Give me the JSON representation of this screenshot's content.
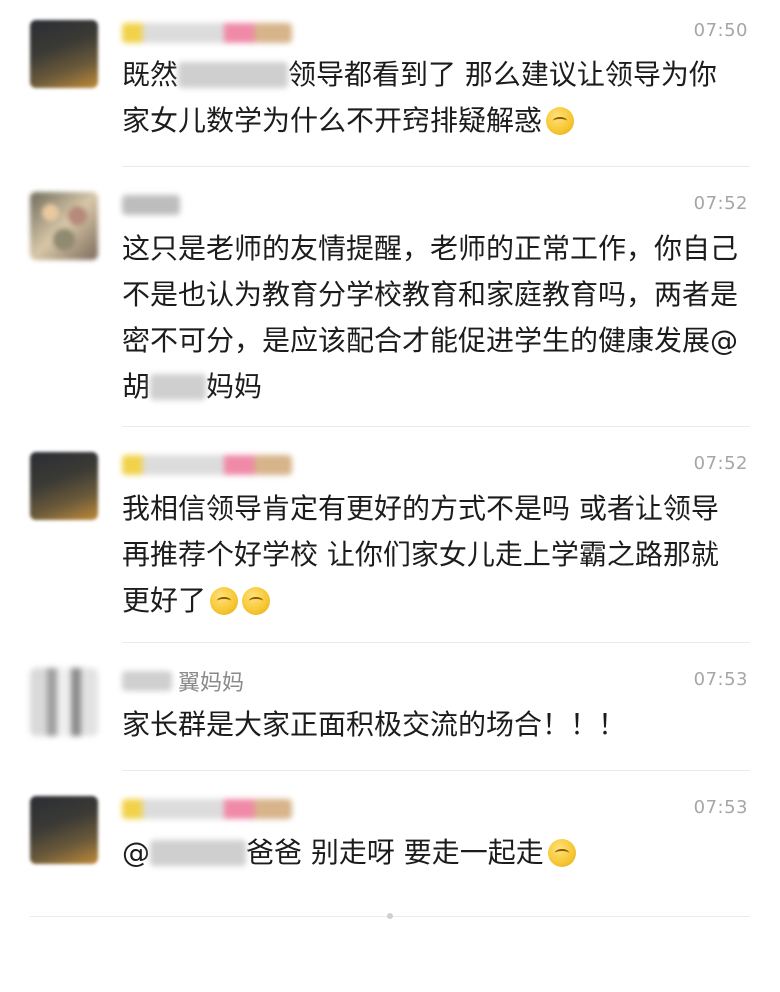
{
  "messages": [
    {
      "name_visible": "",
      "time": "07:50",
      "text_parts": [
        "既然",
        "领导都看到了 那么建议让领导为你家女儿数学为什么不开窍排疑解惑"
      ],
      "emoji": "thinking-face"
    },
    {
      "name_visible": "",
      "time": "07:52",
      "text_parts": [
        "这只是老师的友情提醒，老师的正常工作，你自己不是也认为教育分学校教育和家庭教育吗，两者是密不可分，是应该配合才能促进学生的健康发展@胡",
        "妈妈"
      ]
    },
    {
      "name_visible": "",
      "time": "07:52",
      "text_parts": [
        "我相信领导肯定有更好的方式不是吗 或者让领导再推荐个好学校 让你们家女儿走上学霸之路那就更好了"
      ],
      "emoji": "thinking-face"
    },
    {
      "name_visible": "翼妈妈",
      "time": "07:53",
      "text_parts": [
        "家长群是大家正面积极交流的场合！！！"
      ]
    },
    {
      "name_visible": "",
      "time": "07:53",
      "text_parts": [
        "@",
        "爸爸 别走呀 要走一起走"
      ],
      "emoji": "thinking-face"
    }
  ],
  "colors": {
    "time": "#a6a6a6",
    "text": "#1c1c1c",
    "divider": "#ebebeb"
  }
}
